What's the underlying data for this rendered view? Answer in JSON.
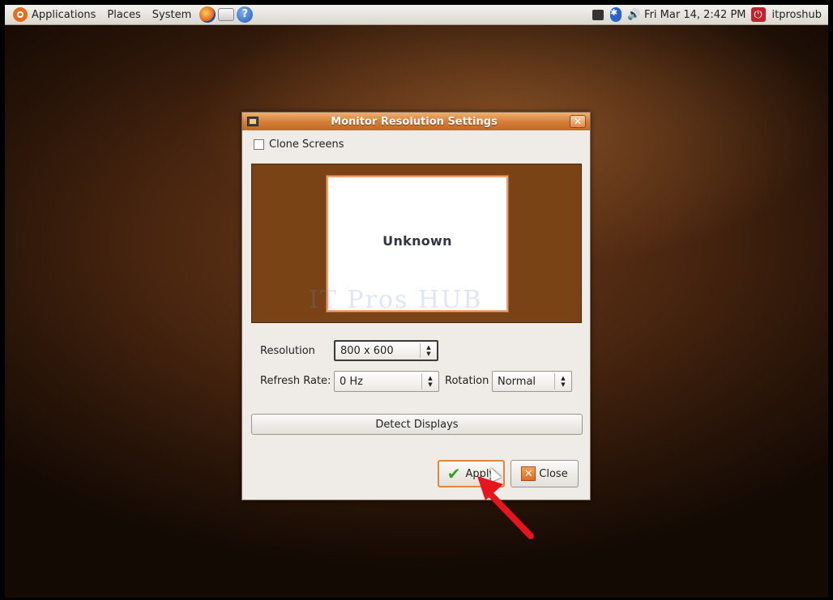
{
  "top_panel": {
    "menus": [
      "Applications",
      "Places",
      "System"
    ],
    "clock": "Fri Mar 14,  2:42 PM",
    "username": "itproshub",
    "help_glyph": "?"
  },
  "dialog": {
    "title": "Monitor Resolution Settings",
    "clone_screens_label": "Clone Screens",
    "clone_screens_checked": false,
    "monitor_label": "Unknown",
    "watermark_text": "IT Pros HUB",
    "resolution_label": "Resolution",
    "resolution_value": "800 x 600",
    "refresh_rate_label": "Refresh Rate:",
    "refresh_rate_value": "0 Hz",
    "rotation_label": "Rotation",
    "rotation_value": "Normal",
    "detect_displays_label": "Detect Displays",
    "apply_label": "Apply",
    "close_label": "Close"
  },
  "colors": {
    "accent_orange": "#d27c36",
    "annotation_red": "#e8141c",
    "monitor_bg": "#7a4316"
  },
  "icons": {
    "menu_logo": "ubuntu-logo-icon",
    "launchers": [
      "firefox-icon",
      "mail-icon",
      "help-icon"
    ],
    "tray": [
      "network-icon",
      "bluetooth-icon",
      "volume-icon",
      "power-icon"
    ],
    "apply": "checkmark-icon",
    "close": "close-x-icon",
    "annotation": "red-arrow-icon"
  }
}
